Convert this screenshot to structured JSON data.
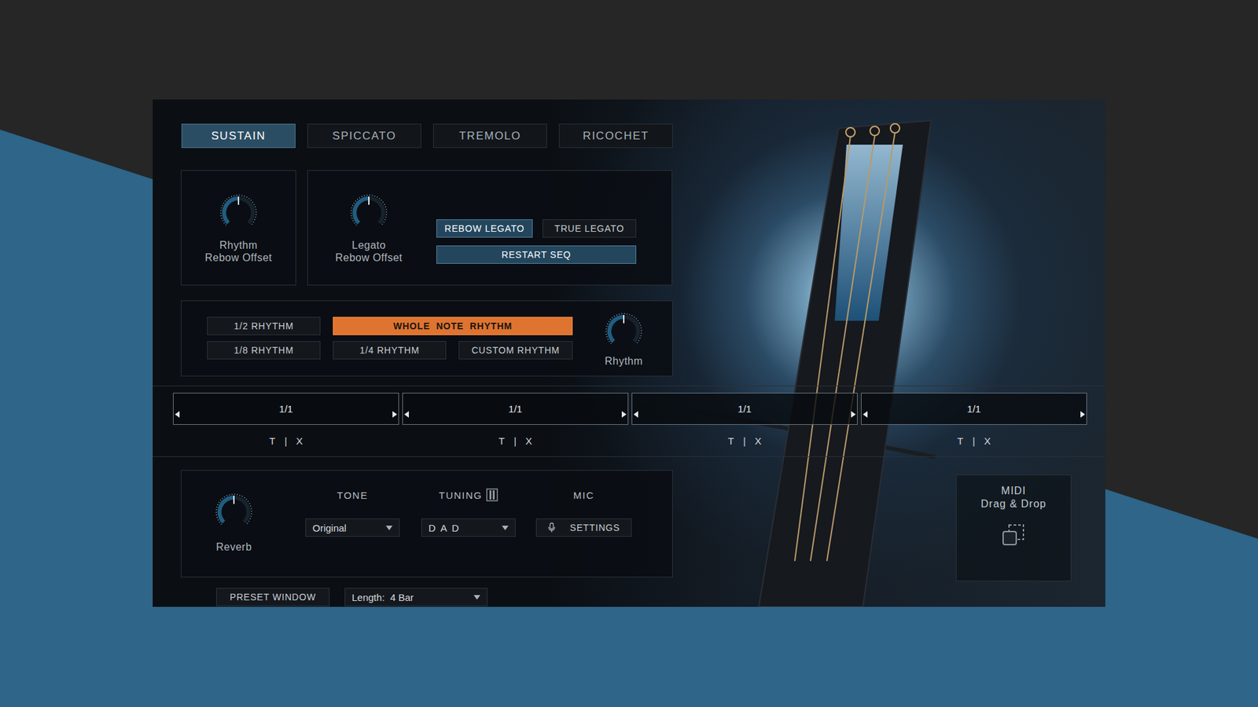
{
  "tabs": [
    {
      "label": "SUSTAIN",
      "selected": true
    },
    {
      "label": "SPICCATO",
      "selected": false
    },
    {
      "label": "TREMOLO",
      "selected": false
    },
    {
      "label": "RICOCHET",
      "selected": false
    }
  ],
  "rhythm_rebow_knob": {
    "lines": [
      "Rhythm",
      "Rebow Offset"
    ],
    "level": 0.5
  },
  "legato_rebow_knob": {
    "lines": [
      "Legato",
      "Rebow Offset"
    ],
    "level": 0.5
  },
  "legato_modes": [
    {
      "label": "REBOW LEGATO",
      "selected": true
    },
    {
      "label": "TRUE LEGATO",
      "selected": false
    }
  ],
  "restart_button": {
    "label": "RESTART SEQ",
    "on": true
  },
  "rhythm_presets": [
    {
      "label": "1/2 RHYTHM",
      "selected": false
    },
    {
      "label": "WHOLE  NOTE  RHYTHM",
      "selected": true
    },
    {
      "label": "1/8 RHYTHM",
      "selected": false
    },
    {
      "label": "1/4 RHYTHM",
      "selected": false
    },
    {
      "label": "CUSTOM RHYTHM",
      "selected": false
    }
  ],
  "rhythm_knob": {
    "lines": [
      "Rhythm"
    ],
    "level": 0.5
  },
  "sequence": {
    "steps": [
      {
        "value": "1/1",
        "controls": [
          "T",
          "|",
          "X"
        ]
      },
      {
        "value": "1/1",
        "controls": [
          "T",
          "|",
          "X"
        ]
      },
      {
        "value": "1/1",
        "controls": [
          "T",
          "|",
          "X"
        ]
      },
      {
        "value": "1/1",
        "controls": [
          "T",
          "|",
          "X"
        ]
      }
    ]
  },
  "sound": {
    "reverb": {
      "lines": [
        "Reverb"
      ],
      "level": 0.5
    },
    "tone": {
      "label": "TONE",
      "value": "Original"
    },
    "tuning": {
      "label": "TUNING",
      "value": "D A D"
    },
    "mic": {
      "label": "MIC",
      "button": "SETTINGS"
    }
  },
  "midi": {
    "lines": [
      "MIDI",
      "Drag & Drop"
    ]
  },
  "preset_button": "PRESET WINDOW",
  "length": {
    "value": "Length:  4 Bar"
  }
}
